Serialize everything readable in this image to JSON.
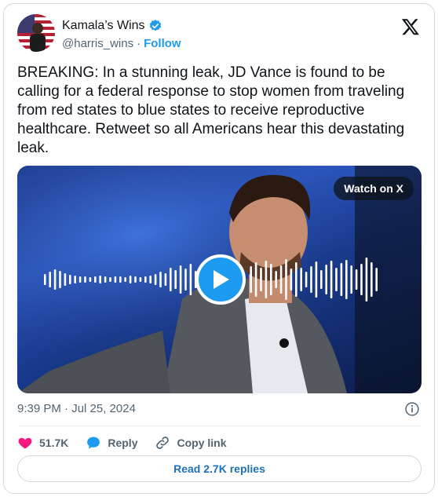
{
  "author": {
    "display_name": "Kamala’s Wins",
    "handle": "@harris_wins",
    "follow_label": "Follow",
    "verified": true
  },
  "tweet": {
    "text": "BREAKING: In a stunning leak, JD Vance is found to be calling for a federal response to stop women from traveling from red states to blue states to receive reproductive healthcare. Retweet so all Americans hear this devastating leak.",
    "timestamp": "9:39 PM · Jul 25, 2024"
  },
  "media": {
    "watch_label": "Watch on X",
    "type": "video-audio"
  },
  "actions": {
    "likes": "51.7K",
    "reply_label": "Reply",
    "copy_link_label": "Copy link",
    "read_replies_label": "Read 2.7K replies"
  },
  "colors": {
    "accent": "#1d9bf0",
    "like": "#f91880",
    "text": "#0f1419",
    "muted": "#536471"
  },
  "icons": {
    "brand": "x-logo-icon",
    "verified": "verified-badge-icon",
    "info": "info-icon",
    "like": "heart-icon",
    "reply": "reply-bubble-icon",
    "link": "link-icon",
    "play": "play-icon"
  }
}
